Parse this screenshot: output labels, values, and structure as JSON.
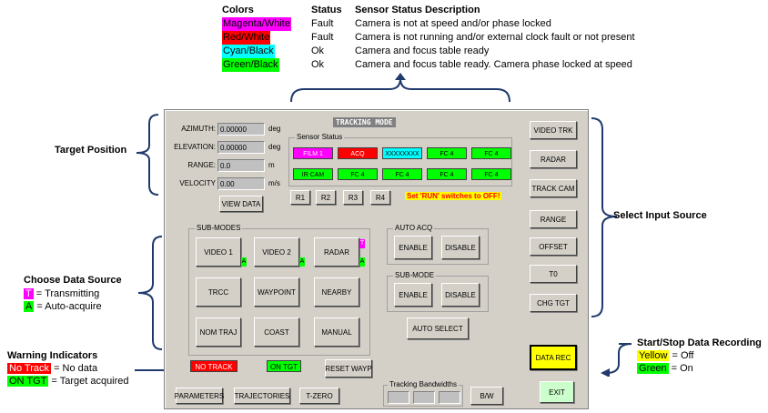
{
  "legend": {
    "headers": {
      "colors": "Colors",
      "status": "Status",
      "desc": "Sensor Status Description"
    },
    "rows": [
      {
        "color": "Magenta/White",
        "bg": "#ff00ff",
        "fg": "#ffffff",
        "status": "Fault",
        "desc": "Camera is not at speed and/or phase locked"
      },
      {
        "color": "Red/White",
        "bg": "#ff0000",
        "fg": "#ffffff",
        "status": "Fault",
        "desc": "Camera is not running and/or external clock fault or not present"
      },
      {
        "color": "Cyan/Black",
        "bg": "#00ffff",
        "fg": "#000000",
        "status": "Ok",
        "desc": "Camera and focus table ready"
      },
      {
        "color": "Green/Black",
        "bg": "#00ff00",
        "fg": "#000000",
        "status": "Ok",
        "desc": "Camera and focus table ready. Camera phase locked at speed"
      }
    ]
  },
  "annotations": {
    "target_position": "Target Position",
    "choose_data_source": "Choose Data Source",
    "transmitting_badge": "T",
    "transmitting": "= Transmitting",
    "autoacq_badge": "A",
    "autoacq": "= Auto-acquire",
    "warning_indicators": "Warning Indicators",
    "no_track": "No Track",
    "no_track_desc": "= No data",
    "on_tgt": "ON TGT",
    "on_tgt_desc": "= Target acquired",
    "select_input": "Select Input Source",
    "recording": "Start/Stop Data Recording",
    "yellow": "Yellow",
    "yellow_desc": "= Off",
    "green": "Green",
    "green_desc": "= On"
  },
  "window": {
    "title": "TRACKING MODE",
    "position": [
      {
        "label": "AZIMUTH:",
        "value": "0.00000",
        "unit": "deg"
      },
      {
        "label": "ELEVATION:",
        "value": "0.00000",
        "unit": "deg"
      },
      {
        "label": "RANGE:",
        "value": "0.0",
        "unit": "m"
      },
      {
        "label": "VELOCITY",
        "value": "0.00",
        "unit": "m/s"
      }
    ],
    "view_data": "VIEW DATA",
    "sensor_status_title": "Sensor Status",
    "sensors_row1": [
      {
        "text": "FILM 1",
        "bg": "#ff00ff",
        "fg": "#ffffff"
      },
      {
        "text": "ACQ",
        "bg": "#ff0000",
        "fg": "#ffffff"
      },
      {
        "text": "XXXXXXXX",
        "bg": "#00ffff",
        "fg": "#000000"
      },
      {
        "text": "FC 4",
        "bg": "#00ff00",
        "fg": "#000000"
      },
      {
        "text": "FC 4",
        "bg": "#00ff00",
        "fg": "#000000"
      }
    ],
    "sensors_row2": [
      {
        "text": "IR CAM",
        "bg": "#00ff00",
        "fg": "#000000"
      },
      {
        "text": "FC 4",
        "bg": "#00ff00",
        "fg": "#000000"
      },
      {
        "text": "FC 4",
        "bg": "#00ff00",
        "fg": "#000000"
      },
      {
        "text": "FC 4",
        "bg": "#00ff00",
        "fg": "#000000"
      },
      {
        "text": "FC 4",
        "bg": "#00ff00",
        "fg": "#000000"
      }
    ],
    "r_buttons": [
      "R1",
      "R2",
      "R3",
      "R4"
    ],
    "run_warning": "Set 'RUN' switches to OFF!",
    "submodes_title": "SUB-MODES",
    "submodes": [
      "VIDEO 1",
      "VIDEO 2",
      "RADAR",
      "TRCC",
      "WAYPOINT",
      "NEARBY",
      "NOM TRAJ",
      "COAST",
      "MANUAL"
    ],
    "badge_a": "A",
    "badge_t": "T",
    "auto_acq_title": "AUTO ACQ",
    "sub_mode_title": "SUB-MODE",
    "enable": "ENABLE",
    "disable": "DISABLE",
    "auto_select": "AUTO SELECT",
    "no_track": "NO TRACK",
    "on_tgt": "ON TGT",
    "reset_waypt": "RESET WAYP",
    "parameters": "PARAMETERS",
    "trajectories": "TRAJECTORIES",
    "tzero": "T-ZERO",
    "bandwidths_title": "Tracking Bandwidths",
    "bw": "B/W",
    "sources": [
      "VIDEO TRK",
      "RADAR",
      "TRACK CAM",
      "RANGE",
      "OFFSET",
      "T0",
      "CHG TGT"
    ],
    "data_rec": "DATA REC",
    "exit": "EXIT"
  }
}
